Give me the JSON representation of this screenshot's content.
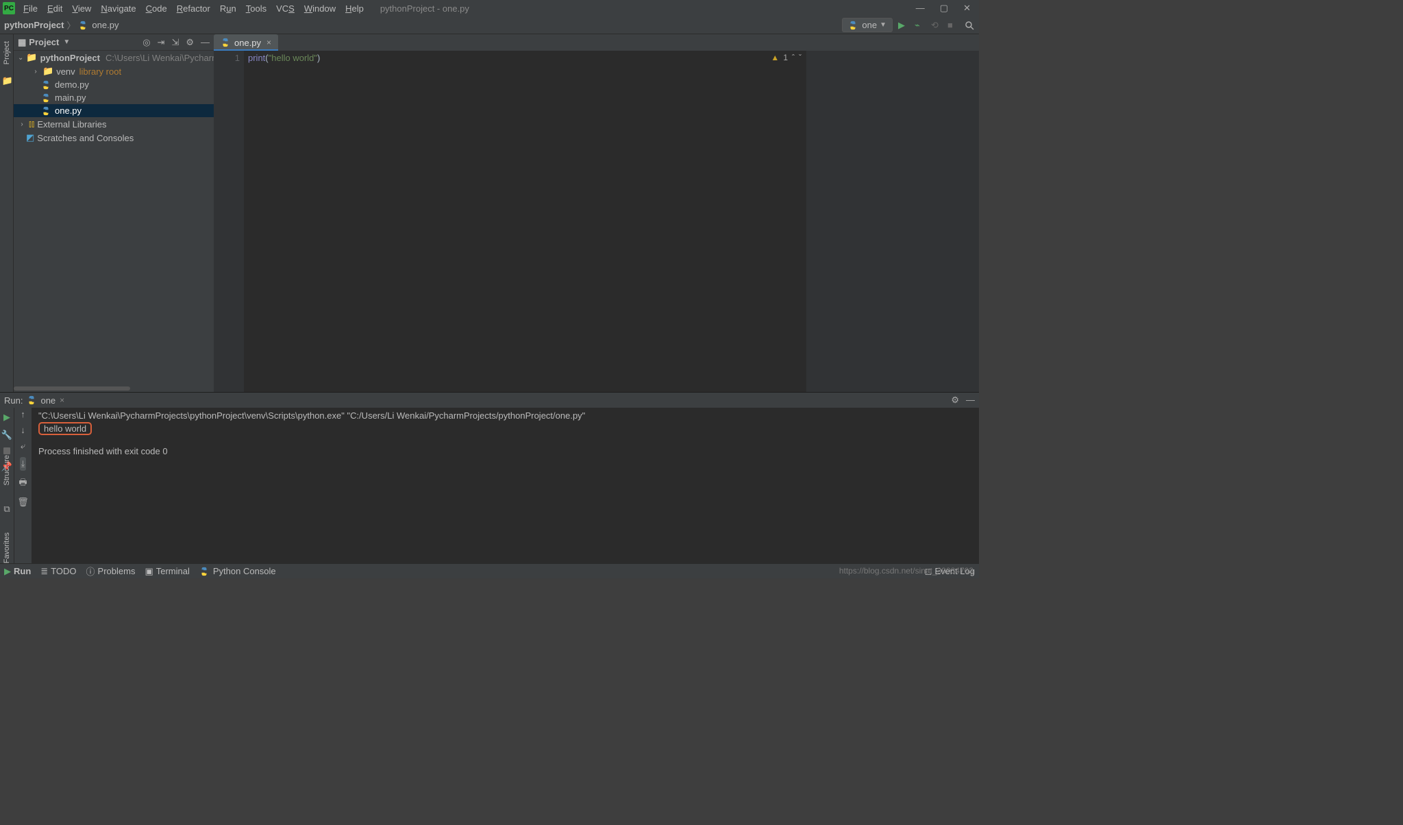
{
  "window": {
    "title": "pythonProject - one.py"
  },
  "menu": {
    "items": [
      "File",
      "Edit",
      "View",
      "Navigate",
      "Code",
      "Refactor",
      "Run",
      "Tools",
      "VCS",
      "Window",
      "Help"
    ]
  },
  "breadcrumb": {
    "project": "pythonProject",
    "file": "one.py"
  },
  "run_config": {
    "name": "one"
  },
  "project_panel": {
    "title": "Project",
    "root": {
      "name": "pythonProject",
      "path": "C:\\Users\\Li Wenkai\\PycharmProjects\\"
    },
    "venv": {
      "name": "venv",
      "note": "library root"
    },
    "files": [
      "demo.py",
      "main.py",
      "one.py"
    ],
    "external": "External Libraries",
    "scratches": "Scratches and Consoles"
  },
  "editor": {
    "tab": "one.py",
    "line_no": "1",
    "code": {
      "print": "print",
      "lp": "(",
      "str": "\"hello world\"",
      "rp": ")"
    },
    "warn_count": "1"
  },
  "run_panel": {
    "title": "Run:",
    "tab": "one",
    "cmd": "\"C:\\Users\\Li Wenkai\\PycharmProjects\\pythonProject\\venv\\Scripts\\python.exe\" \"C:/Users/Li Wenkai/PycharmProjects/pythonProject/one.py\"",
    "output": "hello world",
    "exit": "Process finished with exit code 0"
  },
  "bottom": {
    "run": "Run",
    "todo": "TODO",
    "problems": "Problems",
    "terminal": "Terminal",
    "pyconsole": "Python Console",
    "eventlog": "Event Log"
  },
  "side": {
    "project": "Project",
    "structure": "Structure",
    "favorites": "Favorites"
  },
  "watermark": "https://blog.csdn.net/sinat_39034703"
}
